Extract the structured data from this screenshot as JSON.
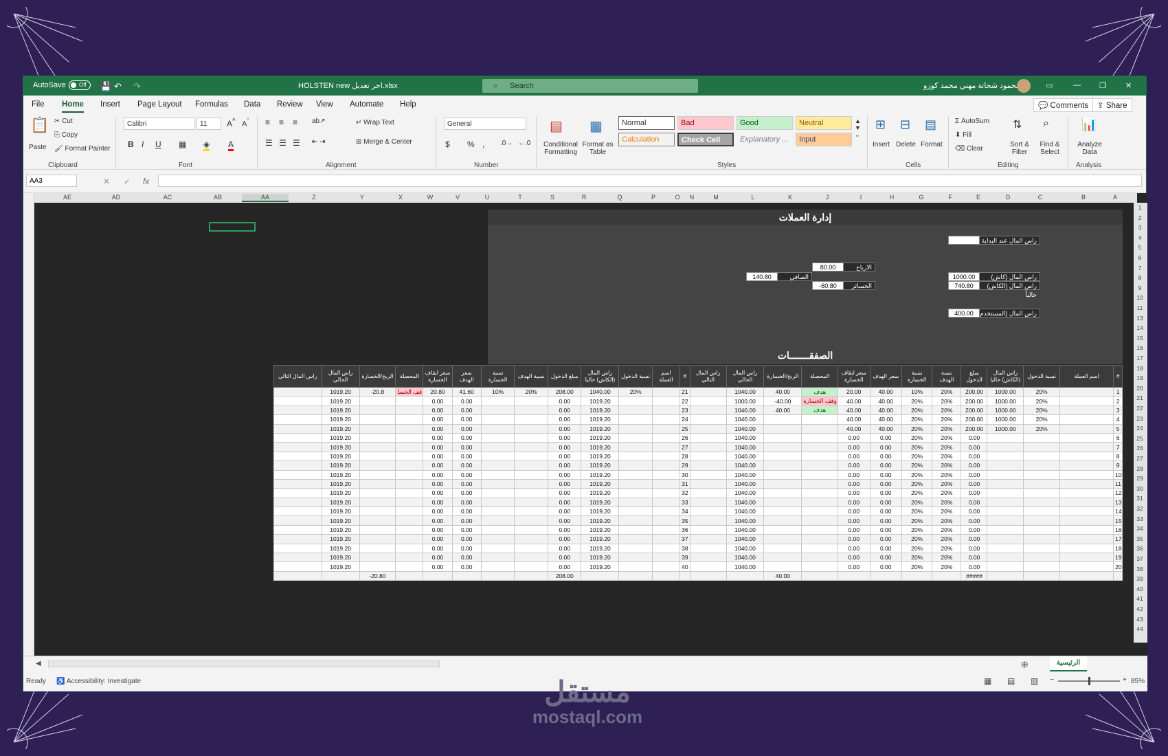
{
  "title": {
    "autosave": "AutoSave",
    "autosave_state": "Off",
    "filename": "HOLSTEN  new اخر تعديل.xlsx",
    "search": "Search",
    "user": "محمود شحاتة مهني محمد كوزو"
  },
  "menu": [
    "File",
    "Home",
    "Insert",
    "Page Layout",
    "Formulas",
    "Data",
    "Review",
    "View",
    "Automate",
    "Help"
  ],
  "menu_right": {
    "comments": "Comments",
    "share": "Share"
  },
  "ribbon": {
    "clipboard": {
      "paste": "Paste",
      "cut": "Cut",
      "copy": "Copy",
      "format_painter": "Format Painter",
      "label": "Clipboard"
    },
    "font": {
      "name": "Calibri",
      "size": "11",
      "label": "Font"
    },
    "alignment": {
      "wrap": "Wrap Text",
      "merge": "Merge & Center",
      "label": "Alignment"
    },
    "number": {
      "format": "General",
      "label": "Number"
    },
    "styles": {
      "cond": "Conditional Formatting",
      "format_table": "Format as Table",
      "normal": "Normal",
      "bad": "Bad",
      "good": "Good",
      "neutral": "Neutral",
      "calculation": "Calculation",
      "check_cell": "Check Cell",
      "explanatory": "Explanatory ...",
      "input": "Input",
      "label": "Styles"
    },
    "cells": {
      "insert": "Insert",
      "delete": "Delete",
      "format": "Format",
      "label": "Cells"
    },
    "editing": {
      "autosum": "AutoSum",
      "fill": "Fill",
      "clear": "Clear",
      "sort": "Sort & Filter",
      "find": "Find & Select",
      "label": "Editing"
    },
    "analysis": {
      "analyze": "Analyze Data",
      "label": "Analysis"
    }
  },
  "namebox": "AA3",
  "columns": [
    "AE",
    "AD",
    "AC",
    "AB",
    "AA",
    "Z",
    "Y",
    "X",
    "W",
    "V",
    "U",
    "T",
    "S",
    "R",
    "Q",
    "P",
    "O",
    "N",
    "M",
    "L",
    "K",
    "J",
    "I",
    "H",
    "G",
    "F",
    "E",
    "D",
    "C",
    "B",
    "A"
  ],
  "rows": [
    "1",
    "2",
    "3",
    "4",
    "5",
    "6",
    "7",
    "8",
    "9",
    "10",
    "11",
    "13",
    "14",
    "15",
    "16",
    "17",
    "18",
    "19",
    "20",
    "21",
    "22",
    "23",
    "24",
    "25",
    "26",
    "27",
    "28",
    "29",
    "30",
    "31",
    "32",
    "33",
    "34",
    "35",
    "36",
    "37",
    "38",
    "39",
    "40",
    "41",
    "42",
    "43",
    "44"
  ],
  "summary": {
    "title": "إدارة العملات",
    "initial_capital_label": "راس المال عند البداية",
    "initial_capital_value": "",
    "cash_capital_label": "راس المال (كاش)",
    "cash_capital_value": "1000.00",
    "current_capital_label": "راس المال (الكاش) حالياً",
    "current_capital_value": "740.80",
    "used_capital_label": "راس المال (المستخدم)",
    "used_capital_value": "400.00",
    "profits_label": "الارباح",
    "profits_value": "80.00",
    "losses_label": "الخسائر",
    "losses_value": "-60.80",
    "net_label": "الصافي",
    "net_value": "140.80"
  },
  "trades_title": "الصفقـــــــات",
  "table_headers": [
    "راس المال التالي",
    "راس المال الحالي",
    "الربح/الخسارة",
    "المحصلة",
    "سعر ايقاف الخسارة",
    "سعر الهدف",
    "نسبة الخسارة",
    "نسبة الهدف",
    "مبلغ الدخول",
    "راس المال (الكاش) حاليا",
    "نسبة الدخول",
    "اسم العملة",
    "#",
    "راس المال التالي",
    "راس المال الحالي",
    "الربح/الخسارة",
    "المحصلة",
    "سعر ايقاف الخسارة",
    "سعر الهدف",
    "نسبة الخسارة",
    "نسبة الهدف",
    "مبلغ الدخول",
    "راس المال (الكاش) حاليا",
    "نسبة الدخول",
    "اسم العملة",
    "#"
  ],
  "table_rows": [
    [
      "",
      "1019.20",
      "-20.8",
      "قف الخسا",
      "20.80",
      "41.60",
      "10%",
      "20%",
      "208.00",
      "1040.00",
      "20%",
      "",
      "21",
      "",
      "1040.00",
      "40.00",
      "هدف",
      "20.00",
      "40.00",
      "10%",
      "20%",
      "200.00",
      "1000.00",
      "20%",
      "",
      "1"
    ],
    [
      "",
      "1019.20",
      "",
      "",
      "0.00",
      "0.00",
      "",
      "",
      "0.00",
      "1019.20",
      "",
      "",
      "22",
      "",
      "1000.00",
      "-40.00",
      "وقف الخسارة",
      "40.00",
      "40.00",
      "20%",
      "20%",
      "200.00",
      "1000.00",
      "20%",
      "",
      "2"
    ],
    [
      "",
      "1019.20",
      "",
      "",
      "0.00",
      "0.00",
      "",
      "",
      "0.00",
      "1019.20",
      "",
      "",
      "23",
      "",
      "1040.00",
      "40.00",
      "هدف",
      "40.00",
      "40.00",
      "20%",
      "20%",
      "200.00",
      "1000.00",
      "20%",
      "",
      "3"
    ],
    [
      "",
      "1019.20",
      "",
      "",
      "0.00",
      "0.00",
      "",
      "",
      "0.00",
      "1019.20",
      "",
      "",
      "24",
      "",
      "1040.00",
      "",
      "",
      "40.00",
      "40.00",
      "20%",
      "20%",
      "200.00",
      "1000.00",
      "20%",
      "",
      "4"
    ],
    [
      "",
      "1019.20",
      "",
      "",
      "0.00",
      "0.00",
      "",
      "",
      "0.00",
      "1019.20",
      "",
      "",
      "25",
      "",
      "1040.00",
      "",
      "",
      "40.00",
      "40.00",
      "20%",
      "20%",
      "200.00",
      "1000.00",
      "20%",
      "",
      "5"
    ],
    [
      "",
      "1019.20",
      "",
      "",
      "0.00",
      "0.00",
      "",
      "",
      "0.00",
      "1019.20",
      "",
      "",
      "26",
      "",
      "1040.00",
      "",
      "",
      "0.00",
      "0.00",
      "20%",
      "20%",
      "0.00",
      "",
      "",
      "",
      "6"
    ],
    [
      "",
      "1019.20",
      "",
      "",
      "0.00",
      "0.00",
      "",
      "",
      "0.00",
      "1019.20",
      "",
      "",
      "27",
      "",
      "1040.00",
      "",
      "",
      "0.00",
      "0.00",
      "20%",
      "20%",
      "0.00",
      "",
      "",
      "",
      "7"
    ],
    [
      "",
      "1019.20",
      "",
      "",
      "0.00",
      "0.00",
      "",
      "",
      "0.00",
      "1019.20",
      "",
      "",
      "28",
      "",
      "1040.00",
      "",
      "",
      "0.00",
      "0.00",
      "20%",
      "20%",
      "0.00",
      "",
      "",
      "",
      "8"
    ],
    [
      "",
      "1019.20",
      "",
      "",
      "0.00",
      "0.00",
      "",
      "",
      "0.00",
      "1019.20",
      "",
      "",
      "29",
      "",
      "1040.00",
      "",
      "",
      "0.00",
      "0.00",
      "20%",
      "20%",
      "0.00",
      "",
      "",
      "",
      "9"
    ],
    [
      "",
      "1019.20",
      "",
      "",
      "0.00",
      "0.00",
      "",
      "",
      "0.00",
      "1019.20",
      "",
      "",
      "30",
      "",
      "1040.00",
      "",
      "",
      "0.00",
      "0.00",
      "20%",
      "20%",
      "0.00",
      "",
      "",
      "",
      "10"
    ],
    [
      "",
      "1019.20",
      "",
      "",
      "0.00",
      "0.00",
      "",
      "",
      "0.00",
      "1019.20",
      "",
      "",
      "31",
      "",
      "1040.00",
      "",
      "",
      "0.00",
      "0.00",
      "20%",
      "20%",
      "0.00",
      "",
      "",
      "",
      "11"
    ],
    [
      "",
      "1019.20",
      "",
      "",
      "0.00",
      "0.00",
      "",
      "",
      "0.00",
      "1019.20",
      "",
      "",
      "32",
      "",
      "1040.00",
      "",
      "",
      "0.00",
      "0.00",
      "20%",
      "20%",
      "0.00",
      "",
      "",
      "",
      "12"
    ],
    [
      "",
      "1019.20",
      "",
      "",
      "0.00",
      "0.00",
      "",
      "",
      "0.00",
      "1019.20",
      "",
      "",
      "33",
      "",
      "1040.00",
      "",
      "",
      "0.00",
      "0.00",
      "20%",
      "20%",
      "0.00",
      "",
      "",
      "",
      "13"
    ],
    [
      "",
      "1019.20",
      "",
      "",
      "0.00",
      "0.00",
      "",
      "",
      "0.00",
      "1019.20",
      "",
      "",
      "34",
      "",
      "1040.00",
      "",
      "",
      "0.00",
      "0.00",
      "20%",
      "20%",
      "0.00",
      "",
      "",
      "",
      "14"
    ],
    [
      "",
      "1019.20",
      "",
      "",
      "0.00",
      "0.00",
      "",
      "",
      "0.00",
      "1019.20",
      "",
      "",
      "35",
      "",
      "1040.00",
      "",
      "",
      "0.00",
      "0.00",
      "20%",
      "20%",
      "0.00",
      "",
      "",
      "",
      "15"
    ],
    [
      "",
      "1019.20",
      "",
      "",
      "0.00",
      "0.00",
      "",
      "",
      "0.00",
      "1019.20",
      "",
      "",
      "36",
      "",
      "1040.00",
      "",
      "",
      "0.00",
      "0.00",
      "20%",
      "20%",
      "0.00",
      "",
      "",
      "",
      "16"
    ],
    [
      "",
      "1019.20",
      "",
      "",
      "0.00",
      "0.00",
      "",
      "",
      "0.00",
      "1019.20",
      "",
      "",
      "37",
      "",
      "1040.00",
      "",
      "",
      "0.00",
      "0.00",
      "20%",
      "20%",
      "0.00",
      "",
      "",
      "",
      "17"
    ],
    [
      "",
      "1019.20",
      "",
      "",
      "0.00",
      "0.00",
      "",
      "",
      "0.00",
      "1019.20",
      "",
      "",
      "38",
      "",
      "1040.00",
      "",
      "",
      "0.00",
      "0.00",
      "20%",
      "20%",
      "0.00",
      "",
      "",
      "",
      "18"
    ],
    [
      "",
      "1019.20",
      "",
      "",
      "0.00",
      "0.00",
      "",
      "",
      "0.00",
      "1019.20",
      "",
      "",
      "39",
      "",
      "1040.00",
      "",
      "",
      "0.00",
      "0.00",
      "20%",
      "20%",
      "0.00",
      "",
      "",
      "",
      "19"
    ],
    [
      "",
      "1019.20",
      "",
      "",
      "0.00",
      "0.00",
      "",
      "",
      "0.00",
      "1019.20",
      "",
      "",
      "40",
      "",
      "1040.00",
      "",
      "",
      "0.00",
      "0.00",
      "20%",
      "20%",
      "0.00",
      "",
      "",
      "",
      "20"
    ],
    [
      "",
      "",
      "-20.80",
      "",
      "",
      "",
      "",
      "",
      "208.00",
      "",
      "",
      "",
      "",
      "",
      "",
      "40.00",
      "",
      "",
      "",
      "",
      "",
      "#####",
      "",
      "",
      "",
      ""
    ]
  ],
  "sheet_tab": "الرئيسية",
  "status": {
    "ready": "Ready",
    "accessibility": "Accessibility: Investigate",
    "zoom": "85%"
  },
  "watermark": {
    "arabic": "مستقل",
    "latin": "mostaql.com"
  }
}
